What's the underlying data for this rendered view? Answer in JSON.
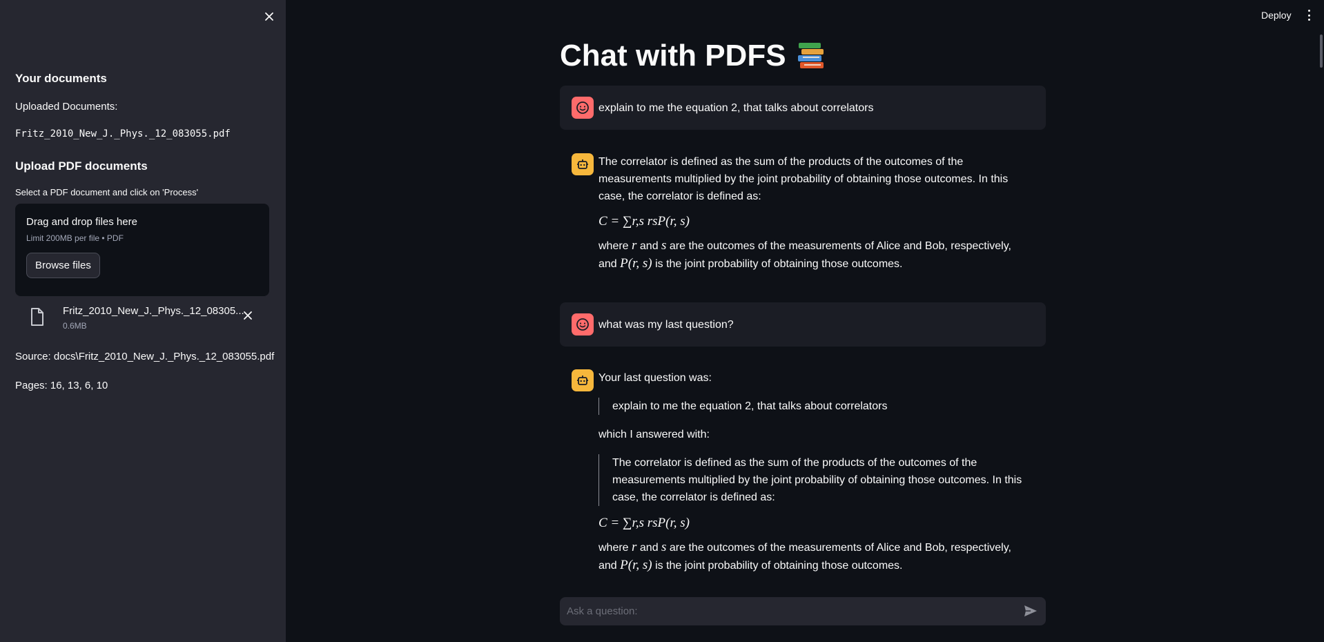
{
  "sidebar": {
    "docs_title": "Your documents",
    "uploaded_label": "Uploaded Documents:",
    "uploaded_file": "Fritz_2010_New_J._Phys._12_083055.pdf",
    "upload_title": "Upload PDF documents",
    "upload_hint": "Select a PDF document and click on 'Process'",
    "dropzone": {
      "title": "Drag and drop files here",
      "subtitle": "Limit 200MB per file • PDF",
      "browse_label": "Browse files"
    },
    "file": {
      "name": "Fritz_2010_New_J._Phys._12_08305...",
      "size": "0.6MB"
    },
    "source": "Source: docs\\Fritz_2010_New_J._Phys._12_083055.pdf",
    "pages": "Pages: 16, 13, 6, 10"
  },
  "header": {
    "deploy_label": "Deploy"
  },
  "main": {
    "title": "Chat with PDFS",
    "title_emoji": "books-icon",
    "messages": [
      {
        "role": "user",
        "text": "explain to me the equation 2, that talks about correlators"
      },
      {
        "role": "assistant",
        "p1": "The correlator is defined as the sum of the products of the outcomes of the measurements multiplied by the joint probability of obtaining those outcomes. In this case, the correlator is defined as:",
        "equation": "C = ∑r,s rsP(r, s)",
        "p2_a": "where",
        "p2_r": "r",
        "p2_and": "and",
        "p2_s": "s",
        "p2_b": "are the outcomes of the measurements of Alice and Bob, respectively, and",
        "p2_prs": "P(r, s)",
        "p2_c": "is the joint probability of obtaining those outcomes."
      },
      {
        "role": "user",
        "text": "what was my last question?"
      },
      {
        "role": "assistant",
        "p1": "Your last question was:",
        "quote1": "explain to me the equation 2, that talks about correlators",
        "p2": "which I answered with:",
        "quote2": "The correlator is defined as the sum of the products of the outcomes of the measurements multiplied by the joint probability of obtaining those outcomes. In this case, the correlator is defined as:",
        "equation": "C = ∑r,s rsP(r, s)",
        "p3_a": "where",
        "p3_r": "r",
        "p3_and": "and",
        "p3_s": "s",
        "p3_b": "are the outcomes of the measurements of Alice and Bob, respectively, and",
        "p3_prs": "P(r, s)",
        "p3_c": "is the joint probability of obtaining those outcomes."
      }
    ],
    "input_placeholder": "Ask a question:"
  },
  "colors": {
    "background": "#0e1117",
    "sidebar": "#262730",
    "user_avatar": "#ff6b6b",
    "bot_avatar": "#f6b73c"
  }
}
